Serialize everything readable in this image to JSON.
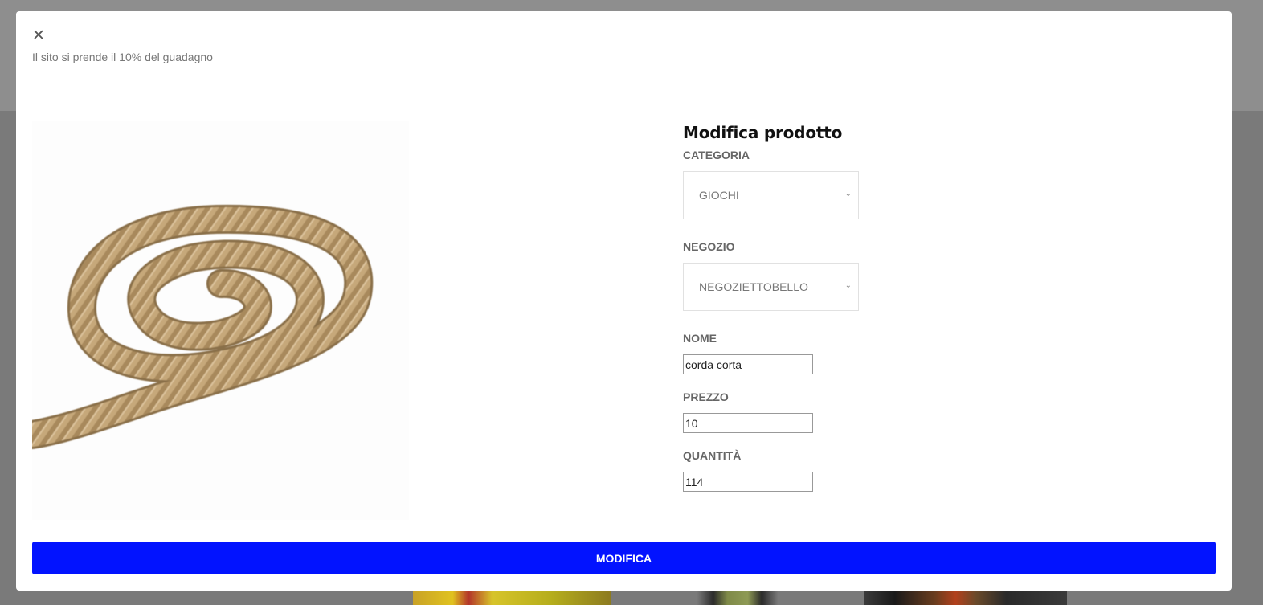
{
  "modal": {
    "close_icon": "close-icon",
    "close_glyph": "✕",
    "note": "Il sito si prende il 10% del guadagno",
    "image_alt": "rope coil"
  },
  "form": {
    "title": "Modifica prodotto",
    "categoria_label": "CATEGORIA",
    "categoria_value": "GIOCHI",
    "negozio_label": "NEGOZIO",
    "negozio_value": "NEGOZIETTOBELLO",
    "nome_label": "NOME",
    "nome_value": "corda corta",
    "prezzo_label": "PREZZO",
    "prezzo_value": "10",
    "quantita_label": "QUANTITÀ",
    "quantita_value": "114",
    "submit_label": "MODIFICA"
  },
  "colors": {
    "submit_button": "#0213ff",
    "overlay": "#8f8f8f"
  }
}
